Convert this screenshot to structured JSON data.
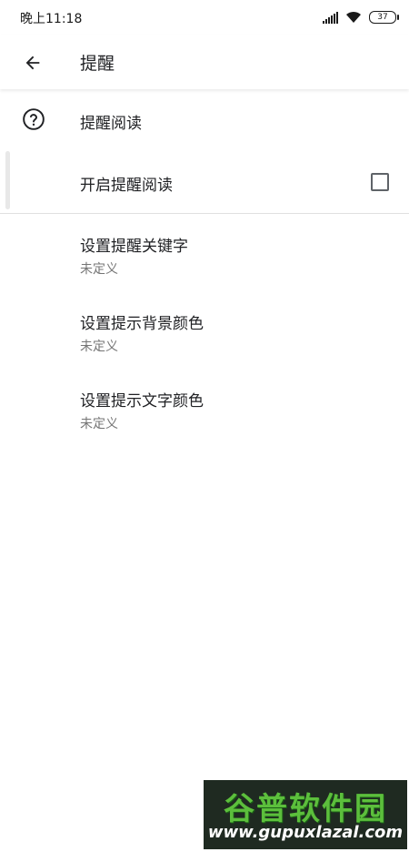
{
  "status_bar": {
    "time": "晚上11:18",
    "battery": "37"
  },
  "app_bar": {
    "title": "提醒"
  },
  "category": {
    "title": "提醒阅读"
  },
  "toggle": {
    "label": "开启提醒阅读",
    "checked": false
  },
  "prefs": [
    {
      "title": "设置提醒关键字",
      "summary": "未定义"
    },
    {
      "title": "设置提示背景颜色",
      "summary": "未定义"
    },
    {
      "title": "设置提示文字颜色",
      "summary": "未定义"
    }
  ],
  "watermark": {
    "brand": "谷普软件园",
    "url": "www.gupuxlazal.com"
  },
  "icons": [
    "back-arrow-icon",
    "help-icon",
    "signal-icon",
    "wifi-icon",
    "battery-icon"
  ]
}
